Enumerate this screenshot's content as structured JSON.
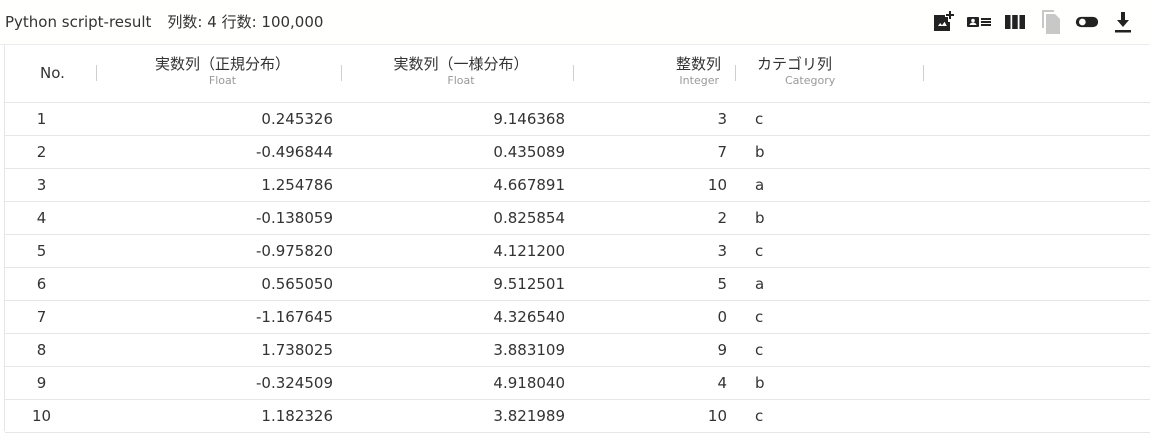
{
  "header": {
    "title": "Python script-result",
    "columns_label": "列数: 4",
    "rows_label": "行数: 100,000"
  },
  "toolbar": {
    "icons": [
      "add-photo-icon",
      "card-view-icon",
      "column-view-icon",
      "copy-icon",
      "toggle-icon",
      "download-icon"
    ],
    "icon_color": "#222222",
    "disabled_color": "#c8c8c8"
  },
  "table": {
    "columns": [
      {
        "name": "No.",
        "type": ""
      },
      {
        "name": "実数列（正規分布）",
        "type": "Float"
      },
      {
        "name": "実数列（一様分布）",
        "type": "Float"
      },
      {
        "name": "整数列",
        "type": "Integer"
      },
      {
        "name": "カテゴリ列",
        "type": "Category"
      }
    ],
    "rows": [
      [
        "1",
        "0.245326",
        "9.146368",
        "3",
        "c"
      ],
      [
        "2",
        "-0.496844",
        "0.435089",
        "7",
        "b"
      ],
      [
        "3",
        "1.254786",
        "4.667891",
        "10",
        "a"
      ],
      [
        "4",
        "-0.138059",
        "0.825854",
        "2",
        "b"
      ],
      [
        "5",
        "-0.975820",
        "4.121200",
        "3",
        "c"
      ],
      [
        "6",
        "0.565050",
        "9.512501",
        "5",
        "a"
      ],
      [
        "7",
        "-1.167645",
        "4.326540",
        "0",
        "c"
      ],
      [
        "8",
        "1.738025",
        "3.883109",
        "9",
        "c"
      ],
      [
        "9",
        "-0.324509",
        "4.918040",
        "4",
        "b"
      ],
      [
        "10",
        "1.182326",
        "3.821989",
        "10",
        "c"
      ]
    ]
  }
}
